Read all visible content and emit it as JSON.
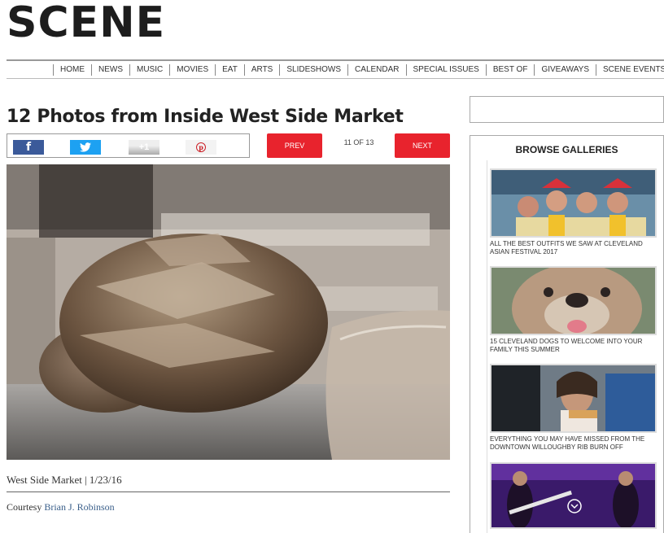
{
  "site": {
    "logo": "SCENE"
  },
  "nav": {
    "items": [
      "HOME",
      "NEWS",
      "MUSIC",
      "MOVIES",
      "EAT",
      "ARTS",
      "SLIDESHOWS",
      "CALENDAR",
      "SPECIAL ISSUES",
      "BEST OF",
      "GIVEAWAYS",
      "SCENE EVENTS"
    ]
  },
  "article": {
    "title": "12 Photos from Inside West Side Market",
    "share": {
      "facebook": "f",
      "twitter": "twitter-bird",
      "google_plus": "+1",
      "pinterest": "pinterest"
    },
    "prev_label": "PREV",
    "next_label": "NEXT",
    "counter": "11 OF 13",
    "caption": "West Side Market | 1/23/16",
    "credit_prefix": "Courtesy ",
    "credit_name": "Brian J. Robinson"
  },
  "sidebar": {
    "gallery_heading": "BROWSE GALLERIES",
    "galleries": [
      {
        "caption": "ALL THE BEST OUTFITS WE SAW AT CLEVELAND ASIAN FESTIVAL 2017"
      },
      {
        "caption": "15 CLEVELAND DOGS TO WELCOME INTO YOUR FAMILY THIS SUMMER"
      },
      {
        "caption": "EVERYTHING YOU MAY HAVE MISSED FROM THE DOWNTOWN WILLOUGHBY RIB BURN OFF"
      },
      {
        "caption": ""
      }
    ]
  },
  "colors": {
    "accent_red": "#e8232d",
    "facebook": "#3b5a9a",
    "twitter": "#1da1f2",
    "link": "#3a5f8a"
  }
}
